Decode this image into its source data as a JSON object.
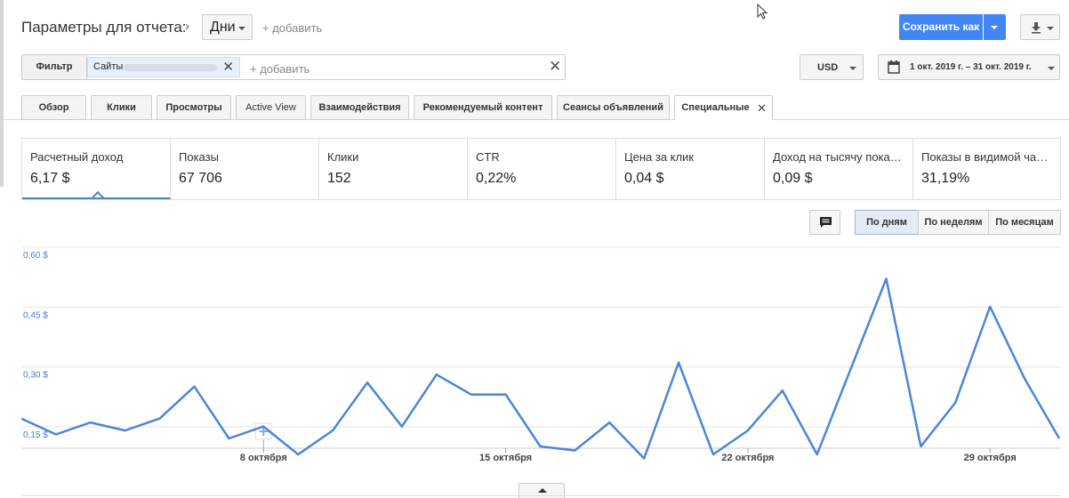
{
  "header": {
    "title": "Параметры для отчета:",
    "dimension": "Дни",
    "add_label": "+ добавить",
    "save_label": "Сохранить как"
  },
  "filter": {
    "label": "Фильтр",
    "chip_label": "Сайты",
    "add_label": "+ добавить"
  },
  "currency": "USD",
  "date_range": "1 окт. 2019 г. – 31 окт. 2019 г.",
  "tabs": [
    {
      "label": "Обзор"
    },
    {
      "label": "Клики"
    },
    {
      "label": "Просмотры"
    },
    {
      "label": "Active View"
    },
    {
      "label": "Взаимодействия"
    },
    {
      "label": "Рекомендуемый контент"
    },
    {
      "label": "Сеансы объявлений"
    },
    {
      "label": "Специальные"
    }
  ],
  "metrics": [
    {
      "label": "Расчетный доход",
      "value": "6,17 $"
    },
    {
      "label": "Показы",
      "value": "67 706"
    },
    {
      "label": "Клики",
      "value": "152"
    },
    {
      "label": "CTR",
      "value": "0,22%"
    },
    {
      "label": "Цена за клик",
      "value": "0,04 $"
    },
    {
      "label": "Доход на тысячу пока…",
      "value": "0,09 $"
    },
    {
      "label": "Показы в видимой ча…",
      "value": "31,19%"
    }
  ],
  "period_buttons": [
    {
      "label": "По дням"
    },
    {
      "label": "По неделям"
    },
    {
      "label": "По месяцам"
    }
  ],
  "chart_data": {
    "type": "line",
    "x": [
      1,
      2,
      3,
      4,
      5,
      6,
      7,
      8,
      9,
      10,
      11,
      12,
      13,
      14,
      15,
      16,
      17,
      18,
      19,
      20,
      21,
      22,
      23,
      24,
      25,
      26,
      27,
      28,
      29,
      30,
      31
    ],
    "series": [
      {
        "values": [
          0.18,
          0.14,
          0.17,
          0.15,
          0.18,
          0.26,
          0.13,
          0.16,
          0.09,
          0.15,
          0.27,
          0.16,
          0.29,
          0.24,
          0.24,
          0.11,
          0.1,
          0.17,
          0.08,
          0.32,
          0.09,
          0.15,
          0.25,
          0.09,
          0.31,
          0.53,
          0.11,
          0.22,
          0.46,
          0.28,
          0.13
        ]
      }
    ],
    "ylim": [
      0.09,
      0.6
    ],
    "yticks": [
      {
        "value": 0.6,
        "label": "0,60 $"
      },
      {
        "value": 0.45,
        "label": "0,45 $"
      },
      {
        "value": 0.3,
        "label": "0,30 $"
      },
      {
        "value": 0.15,
        "label": "0,15 $"
      }
    ],
    "xticks": [
      {
        "day": 8,
        "label": "8 октября"
      },
      {
        "day": 15,
        "label": "15 октября"
      },
      {
        "day": 22,
        "label": "22 октября"
      },
      {
        "day": 29,
        "label": "29 октября"
      }
    ],
    "grid": true,
    "line_color": "#4a86d8"
  }
}
